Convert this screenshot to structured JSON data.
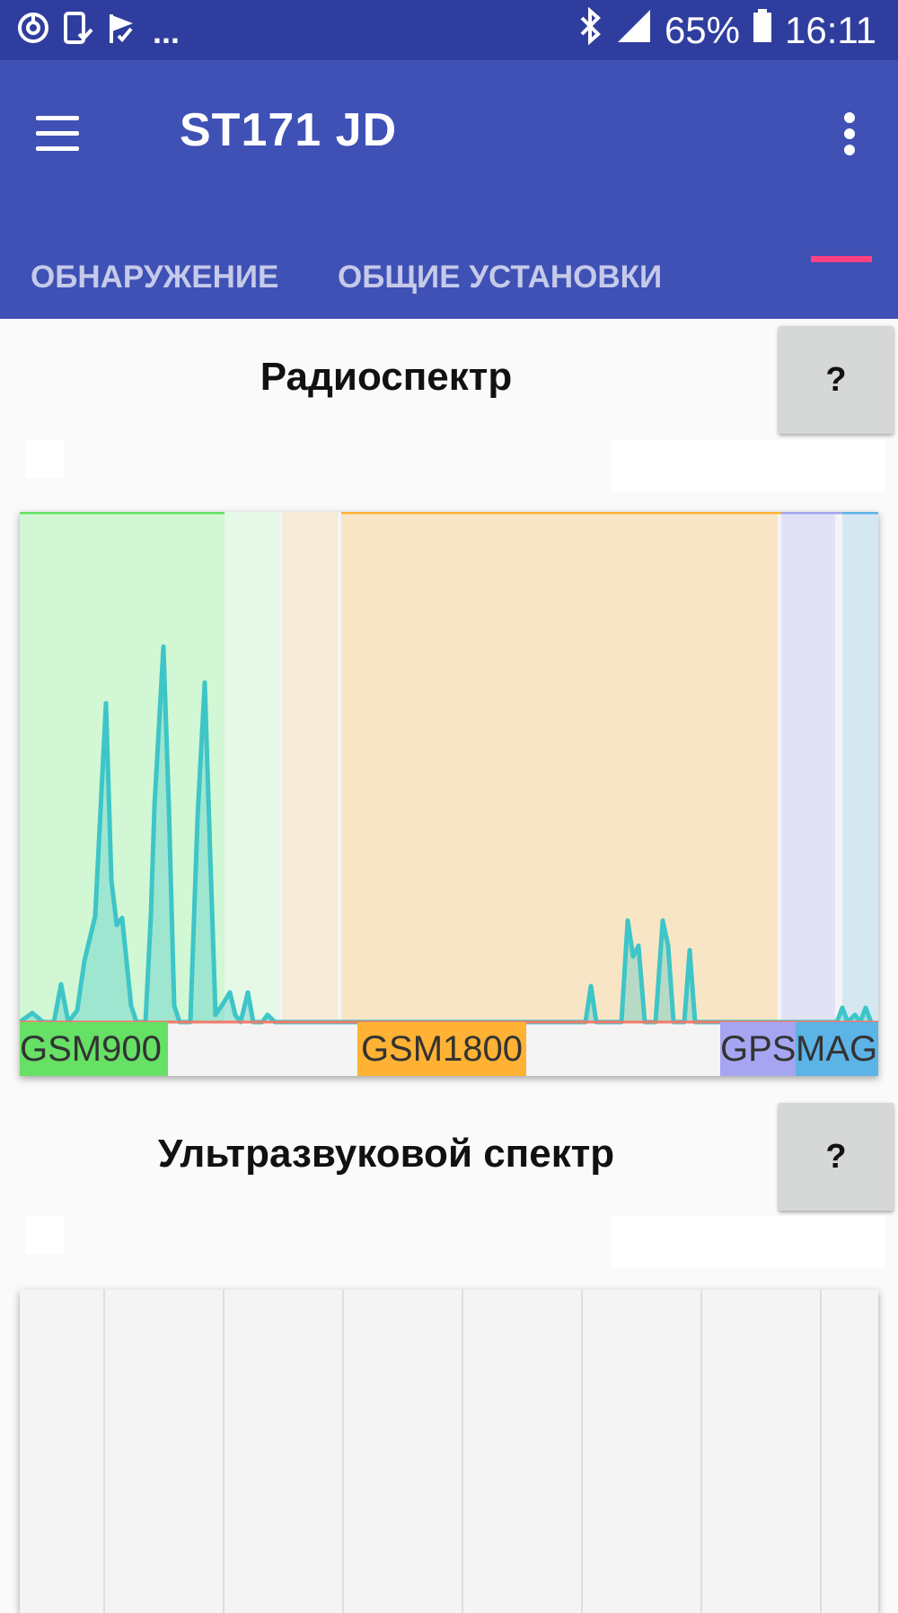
{
  "status_bar": {
    "left_icons": [
      "sync-icon",
      "phone-check-icon",
      "flag-check-icon"
    ],
    "ellipsis": "...",
    "bluetooth_icon": "bluetooth-icon",
    "signal_icon": "signal-icon",
    "battery_percent": "65%",
    "battery_icon": "battery-icon",
    "time": "16:11"
  },
  "app_bar": {
    "title": "ST171 JD",
    "menu_icon": "hamburger-menu-icon",
    "overflow_icon": "more-vert-icon"
  },
  "tabs": [
    {
      "label": "ОБНАРУЖЕНИЕ"
    },
    {
      "label": "ОБЩИЕ УСТАНОВКИ"
    }
  ],
  "radio_section": {
    "title": "Радиоспектр",
    "help_label": "?"
  },
  "radio_chart": {
    "bands": [
      {
        "label": "GSM900",
        "color": "#66e065"
      },
      {
        "label": "GSM1800",
        "color": "#ffb233"
      },
      {
        "label": "GPS",
        "color": "#a5a5f2"
      },
      {
        "label": "MAG",
        "color": "#5cb3e6"
      }
    ],
    "band_regions": [
      "#d1f7d4",
      "#e6f8e8",
      "#f6ebd9",
      "#f8e5c6",
      "#e2e2f7",
      "#d5e8f2"
    ],
    "trace_color": "#3ec5c7"
  },
  "ultrasound_section": {
    "title": "Ультразвуковой спектр",
    "help_label": "?"
  }
}
